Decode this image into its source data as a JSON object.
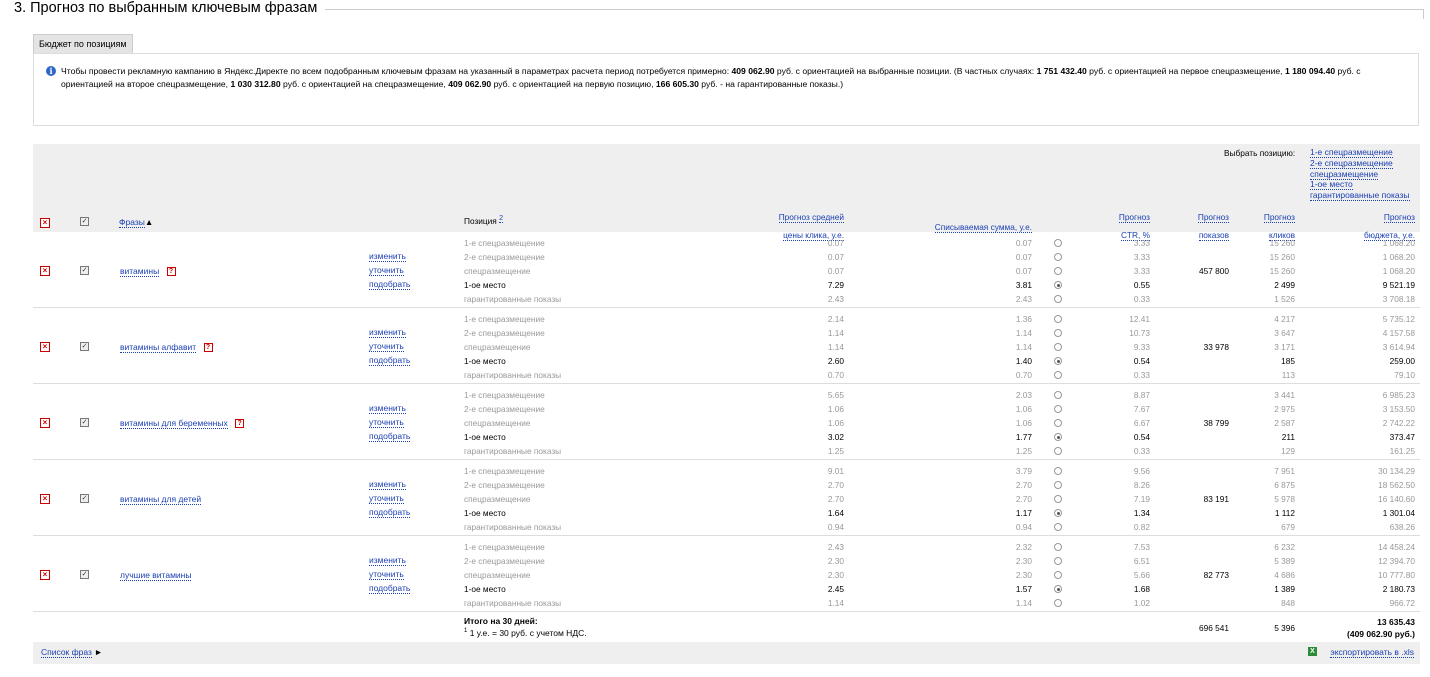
{
  "section": {
    "title": "3. Прогноз по выбранным ключевым фразам"
  },
  "tab": {
    "label": "Бюджет по позициям"
  },
  "info": {
    "t1": "Чтобы провести рекламную кампанию в Яндекс.Директе по всем подобранным ключевым фразам на указанный в параметрах расчета период потребуется примерно: ",
    "b1": "409 062.90",
    "t2": " руб. с ориентацией на выбранные позиции. (В частных случаях: ",
    "b2": "1 751 432.40",
    "t3": " руб. с ориентацией на первое спецразмещение, ",
    "b3": "1 180 094.40",
    "t4": " руб. с ориентацией на второе спецразмещение, ",
    "b4": "1 030 312.80",
    "t5": " руб. с ориентацией на спецразмещение, ",
    "b5": "409 062.90",
    "t6": " руб. с ориентацией на первую позицию, ",
    "b6": "166 605.30",
    "t7": " руб. - на гарантированные показы.)"
  },
  "header": {
    "choose_label": "Выбрать позицию:",
    "choose_links": [
      "1-е спецразмещение",
      "2-е спецразмещение",
      "спецразмещение",
      "1-ое место",
      "гарантированные показы"
    ],
    "phrases": "Фразы",
    "sort_arrow": "▲",
    "position": "Позиция",
    "position_sup": "2",
    "avg_click_1": "Прогноз средней",
    "avg_click_2": "цены клика, у.е.",
    "charged": "Списываемая сумма, у.е.",
    "ctr_1": "Прогноз",
    "ctr_2": "CTR, %",
    "shows_1": "Прогноз",
    "shows_2": "показов",
    "clicks_1": "Прогноз",
    "clicks_2": "кликов",
    "budget_1": "Прогноз",
    "budget_2": "бюджета, у.е."
  },
  "actions": {
    "change": "изменить",
    "refine": "уточнить",
    "pick": "подобрать"
  },
  "position_names": [
    "1-е спецразмещение",
    "2-е спецразмещение",
    "спецразмещение",
    "1-ое место",
    "гарантированные показы"
  ],
  "rows": [
    {
      "phrase": "витамины",
      "help": true,
      "shows": "457 800",
      "bids": [
        "0.07",
        "0.07",
        "0.07",
        "7.29",
        "2.43"
      ],
      "charged": [
        "0.07",
        "0.07",
        "0.07",
        "3.81",
        "2.43"
      ],
      "ctr": [
        "3.33",
        "3.33",
        "3.33",
        "0.55",
        "0.33"
      ],
      "clicks": [
        "15 260",
        "15 260",
        "15 260",
        "2 499",
        "1 526"
      ],
      "budget": [
        "1 068.20",
        "1 068.20",
        "1 068.20",
        "9 521.19",
        "3 708.18"
      ],
      "selected": 3
    },
    {
      "phrase": "витамины алфавит",
      "help": true,
      "shows": "33 978",
      "bids": [
        "2.14",
        "1.14",
        "1.14",
        "2.60",
        "0.70"
      ],
      "charged": [
        "1.36",
        "1.14",
        "1.14",
        "1.40",
        "0.70"
      ],
      "ctr": [
        "12.41",
        "10.73",
        "9.33",
        "0.54",
        "0.33"
      ],
      "clicks": [
        "4 217",
        "3 647",
        "3 171",
        "185",
        "113"
      ],
      "budget": [
        "5 735.12",
        "4 157.58",
        "3 614.94",
        "259.00",
        "79.10"
      ],
      "selected": 3
    },
    {
      "phrase": "витамины для беременных",
      "help": true,
      "shows": "38 799",
      "bids": [
        "5.65",
        "1.06",
        "1.06",
        "3.02",
        "1.25"
      ],
      "charged": [
        "2.03",
        "1.06",
        "1.06",
        "1.77",
        "1.25"
      ],
      "ctr": [
        "8.87",
        "7.67",
        "6.67",
        "0.54",
        "0.33"
      ],
      "clicks": [
        "3 441",
        "2 975",
        "2 587",
        "211",
        "129"
      ],
      "budget": [
        "6 985.23",
        "3 153.50",
        "2 742.22",
        "373.47",
        "161.25"
      ],
      "selected": 3
    },
    {
      "phrase": "витамины для детей",
      "help": false,
      "shows": "83 191",
      "bids": [
        "9.01",
        "2.70",
        "2.70",
        "1.64",
        "0.94"
      ],
      "charged": [
        "3.79",
        "2.70",
        "2.70",
        "1.17",
        "0.94"
      ],
      "ctr": [
        "9.56",
        "8.26",
        "7.19",
        "1.34",
        "0.82"
      ],
      "clicks": [
        "7 951",
        "6 875",
        "5 978",
        "1 112",
        "679"
      ],
      "budget": [
        "30 134.29",
        "18 562.50",
        "16 140.60",
        "1 301.04",
        "638.26"
      ],
      "selected": 3
    },
    {
      "phrase": "лучшие витамины",
      "help": false,
      "shows": "82 773",
      "bids": [
        "2.43",
        "2.30",
        "2.30",
        "2.45",
        "1.14"
      ],
      "charged": [
        "2.32",
        "2.30",
        "2.30",
        "1.57",
        "1.14"
      ],
      "ctr": [
        "7.53",
        "6.51",
        "5.66",
        "1.68",
        "1.02"
      ],
      "clicks": [
        "6 232",
        "5 389",
        "4 686",
        "1 389",
        "848"
      ],
      "budget": [
        "14 458.24",
        "12 394.70",
        "10 777.80",
        "2 180.73",
        "966.72"
      ],
      "selected": 3
    }
  ],
  "total": {
    "label": "Итого на 30 дней:",
    "note_sup": "1",
    "note": " 1 у.е. = 30 руб. с учетом НДС.",
    "shows": "696 541",
    "clicks": "5 396",
    "budget": "13 635.43",
    "budget_rub": "(409 062.90 руб.)"
  },
  "bottom": {
    "phrase_list": "Список фраз",
    "arrow": "►",
    "export": "экспортировать в .xls"
  },
  "icons": {
    "remove": "remove-x-icon",
    "check": "checkbox-icon",
    "help": "help-icon",
    "info": "info-icon",
    "radio": "radio-icon",
    "excel": "excel-icon"
  },
  "colors": {
    "link": "#1a3fb3",
    "remove": "#cc0000",
    "header_bg": "#efefef",
    "muted": "#999999"
  }
}
